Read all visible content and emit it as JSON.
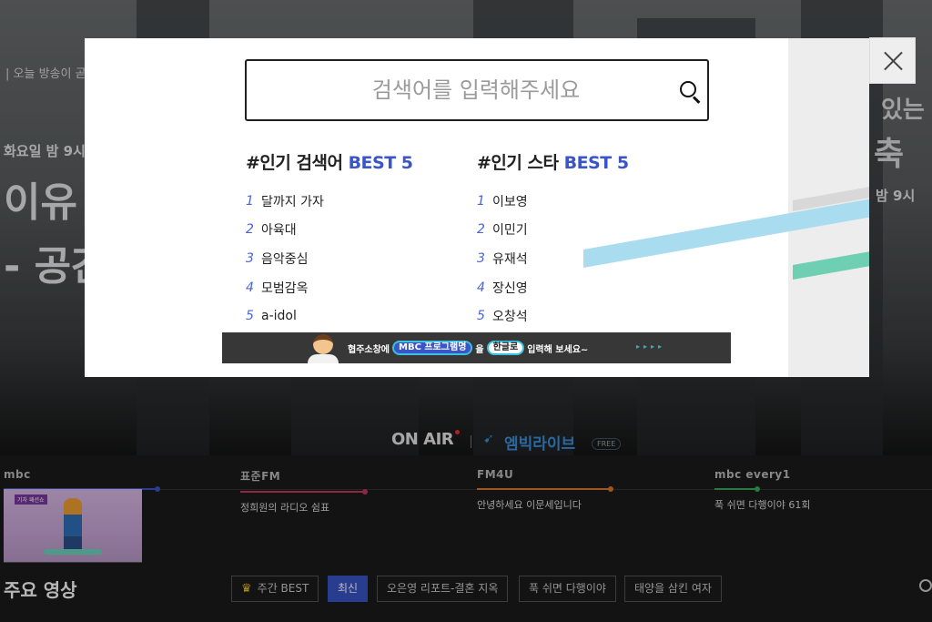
{
  "background": {
    "hero_top": "| 오늘 방송이 곧",
    "hero_day": "화요일 밤 9시",
    "hero_title_1": "이유",
    "hero_title_2": "- 공간",
    "hero_right_1": "있는",
    "hero_right_2": "축",
    "hero_right_3": "밤 9시"
  },
  "onair": {
    "label": "ON AIR",
    "live_label": "엠빅라이브",
    "free_badge": "FREE"
  },
  "channels": [
    {
      "logo": "mbc",
      "program": ""
    },
    {
      "logo": "표준FM",
      "program": "정희원의 라디오 쉼표"
    },
    {
      "logo": "FM4U",
      "program": "안녕하세요 이문세입니다"
    },
    {
      "logo": "mbc every1",
      "program": "푹 쉬면 다행이야 61회"
    }
  ],
  "thumbnail": {
    "tag": "기자 패션쇼"
  },
  "main_section": {
    "title": "주요 영상",
    "chips": [
      "주간 BEST",
      "최신",
      "오은영 리포트-결혼 지옥",
      "푹 쉬면 다행이야",
      "태양을 삼킨 여자"
    ]
  },
  "search": {
    "placeholder": "검색어를 입력해주세요",
    "popular_search": {
      "prefix": "#인기 검색어",
      "best": "BEST 5",
      "items": [
        "달까지 가자",
        "아육대",
        "음악중심",
        "모범감옥",
        "a-idol"
      ]
    },
    "popular_star": {
      "prefix": "#인기 스타",
      "best": "BEST 5",
      "items": [
        "이보영",
        "이민기",
        "유재석",
        "장신영",
        "오창석"
      ]
    },
    "ranks": [
      "1",
      "2",
      "3",
      "4",
      "5"
    ],
    "banner": {
      "part1": "협주소창에",
      "pill1": "MBC 프로그램명",
      "part2": "을",
      "pill2": "한글로",
      "part3": "입력해 보세요~",
      "arrows": "▸▸▸▸"
    }
  },
  "colors": {
    "accent": "#3a55c8",
    "rank_number": "#4a64d6"
  }
}
